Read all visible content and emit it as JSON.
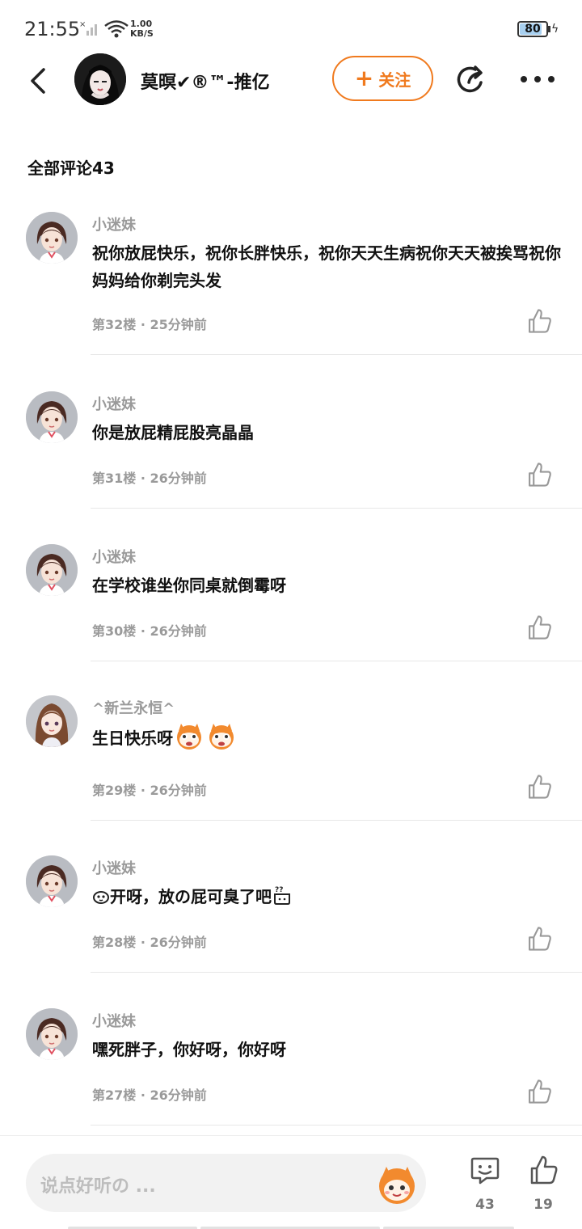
{
  "status_bar": {
    "time": "21:55",
    "net_speed_value": "1.00",
    "net_speed_unit": "KB/S",
    "battery": "80"
  },
  "header": {
    "name": "莫暝✔®™-推亿",
    "follow_label": "关注",
    "follow_plus": "+"
  },
  "section": {
    "title": "全部评论43"
  },
  "comments": [
    {
      "user": "小迷妹",
      "text": "祝你放屁快乐，祝你长胖快乐，祝你天天生病祝你天天被挨骂祝你妈妈给你剃完头发",
      "floor": "第32楼",
      "time": "25分钟前"
    },
    {
      "user": "小迷妹",
      "text": "你是放屁精屁股亮晶晶",
      "floor": "第31楼",
      "time": "26分钟前"
    },
    {
      "user": "小迷妹",
      "text": "在学校谁坐你同桌就倒霉呀",
      "floor": "第30楼",
      "time": "26分钟前"
    },
    {
      "user": "^新兰永恒^",
      "text": "生日快乐呀",
      "floor": "第29楼",
      "time": "26分钟前"
    },
    {
      "user": "小迷妹",
      "text": "开呀，放の屁可臭了吧",
      "floor": "第28楼",
      "time": "26分钟前"
    },
    {
      "user": "小迷妹",
      "text": "嘿死胖子，你好呀，你好呀",
      "floor": "第27楼",
      "time": "26分钟前"
    }
  ],
  "meta_separator": "·",
  "bottom_bar": {
    "placeholder": "说点好听の ...",
    "comment_count": "43",
    "like_count": "19"
  },
  "colors": {
    "accent": "#f07a1e",
    "muted": "#9a9a9a"
  }
}
